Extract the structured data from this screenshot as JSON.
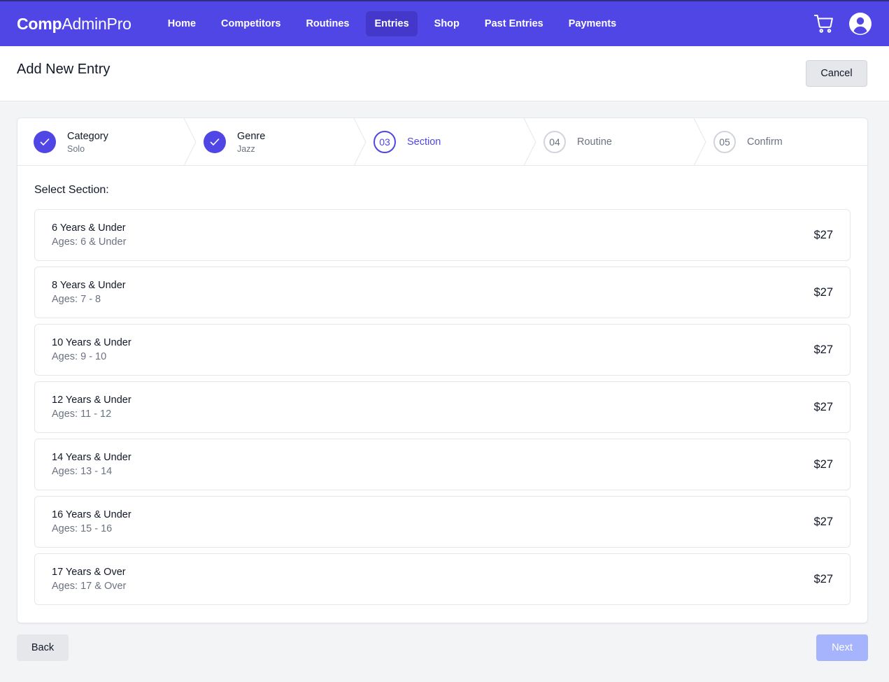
{
  "app": {
    "brand_bold": "Comp",
    "brand_regular": "AdminPro"
  },
  "nav": {
    "items": [
      {
        "label": "Home"
      },
      {
        "label": "Competitors"
      },
      {
        "label": "Routines"
      },
      {
        "label": "Entries",
        "active": true
      },
      {
        "label": "Shop"
      },
      {
        "label": "Past Entries"
      },
      {
        "label": "Payments"
      }
    ],
    "icons": [
      "cart-icon",
      "user-account-icon"
    ]
  },
  "header": {
    "title": "Add New Entry",
    "cancel_label": "Cancel"
  },
  "steps": [
    {
      "label": "Category",
      "sub": "Solo",
      "state": "done"
    },
    {
      "label": "Genre",
      "sub": "Jazz",
      "state": "done"
    },
    {
      "number": "03",
      "label": "Section",
      "state": "current"
    },
    {
      "number": "04",
      "label": "Routine",
      "state": "todo"
    },
    {
      "number": "05",
      "label": "Confirm",
      "state": "todo"
    }
  ],
  "section": {
    "title": "Select Section:",
    "options": [
      {
        "name": "6 Years & Under",
        "ages": "Ages: 6 & Under",
        "price": "$27"
      },
      {
        "name": "8 Years & Under",
        "ages": "Ages: 7 - 8",
        "price": "$27"
      },
      {
        "name": "10 Years & Under",
        "ages": "Ages: 9 - 10",
        "price": "$27"
      },
      {
        "name": "12 Years & Under",
        "ages": "Ages: 11 - 12",
        "price": "$27"
      },
      {
        "name": "14 Years & Under",
        "ages": "Ages: 13 - 14",
        "price": "$27"
      },
      {
        "name": "16 Years & Under",
        "ages": "Ages: 15 - 16",
        "price": "$27"
      },
      {
        "name": "17 Years & Over",
        "ages": "Ages: 17 & Over",
        "price": "$27"
      }
    ]
  },
  "footer": {
    "back_label": "Back",
    "next_label": "Next",
    "next_disabled": true
  },
  "colors": {
    "primary": "#4f46e5",
    "active_nav": "#4338ca",
    "next_disabled": "#a5b4fc"
  }
}
